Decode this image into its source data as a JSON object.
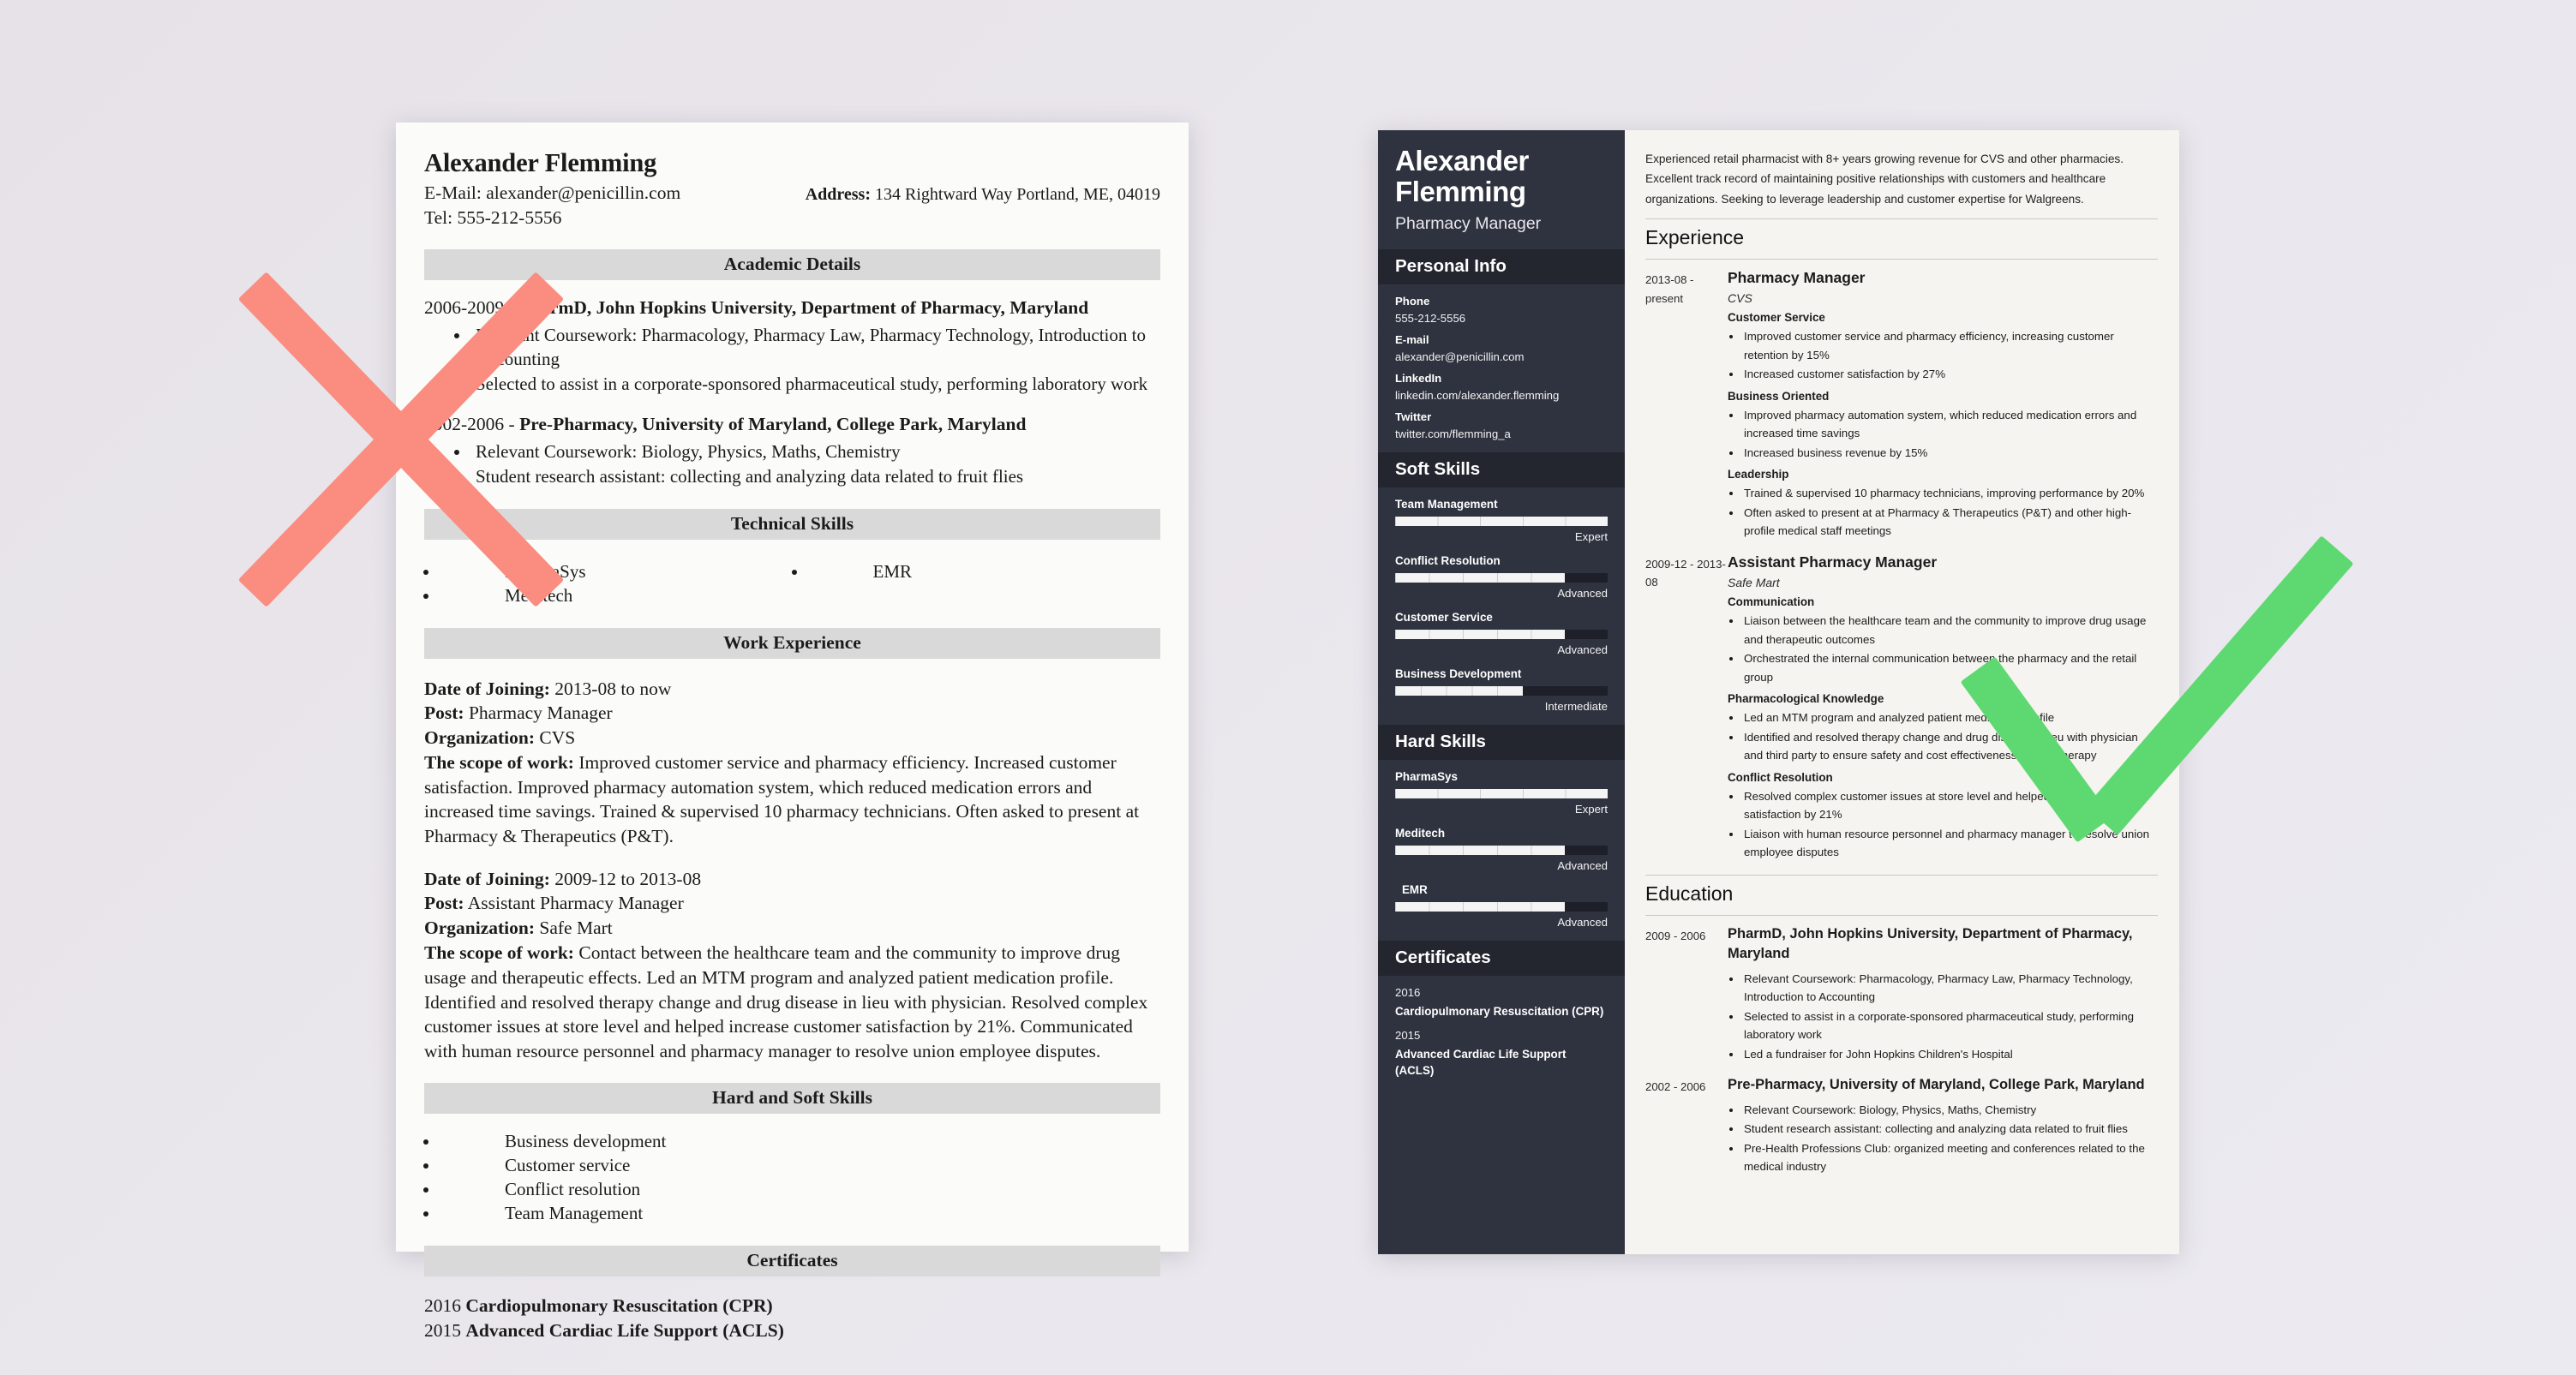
{
  "marks": {
    "reject_color": "#fa8c80",
    "accept_color": "#5ed870",
    "reject_name": "red-x-mark",
    "accept_name": "green-check-mark"
  },
  "bad_resume": {
    "name": "Alexander Flemming",
    "email_line": "E-Mail: alexander@penicillin.com",
    "tel_line": "Tel: 555-212-5556",
    "address_label": "Address:",
    "address_value": "134 Rightward Way Portland, ME, 04019",
    "sections": {
      "academic": "Academic Details",
      "technical": "Technical Skills",
      "work": "Work Experience",
      "skills": "Hard and Soft Skills",
      "certificates": "Certificates"
    },
    "education": [
      {
        "years": "2006-2009 - ",
        "title": "PharmD, John Hopkins University, Department of Pharmacy, Maryland",
        "bullets": [
          "Relevant Coursework: Pharmacology, Pharmacy Law, Pharmacy Technology, Introduction to Accounting",
          "Selected to assist in a corporate-sponsored pharmaceutical study, performing laboratory work"
        ]
      },
      {
        "years": "2002-2006 - ",
        "title": "Pre-Pharmacy, University of Maryland, College Park, Maryland",
        "bullets": [
          "Relevant Coursework: Biology, Physics, Maths, Chemistry",
          "Student research assistant: collecting and analyzing data related to fruit flies"
        ]
      }
    ],
    "technical_skills_left": [
      "PharmaSys",
      "Meditech"
    ],
    "technical_skills_right": [
      "EMR"
    ],
    "jobs": [
      {
        "date_label": "Date of Joining:",
        "date_value": " 2013-08 to now",
        "post_label": "Post:",
        "post_value": " Pharmacy Manager",
        "org_label": "Organization:",
        "org_value": " CVS",
        "scope_label": "The scope of work:",
        "scope_value": " Improved customer service and pharmacy efficiency. Increased customer satisfaction. Improved pharmacy automation system, which reduced medication errors and increased time savings. Trained & supervised 10 pharmacy technicians. Often asked to present at Pharmacy & Therapeutics (P&T)."
      },
      {
        "date_label": "Date of Joining:",
        "date_value": " 2009-12 to 2013-08",
        "post_label": "Post:",
        "post_value": " Assistant Pharmacy Manager",
        "org_label": "Organization:",
        "org_value": " Safe Mart",
        "scope_label": "The scope of work:",
        "scope_value": " Contact between the healthcare team and the community to improve drug usage and therapeutic effects. Led an MTM program and analyzed patient medication profile. Identified and resolved therapy change and drug disease in lieu with physician. Resolved complex customer issues at store level and helped increase customer satisfaction by 21%. Communicated with human resource personnel and pharmacy manager to resolve union employee disputes."
      }
    ],
    "soft_skills": [
      "Business development",
      "Customer service",
      "Conflict resolution",
      "Team Management"
    ],
    "certificates": [
      {
        "year": "2016 ",
        "name": "Cardiopulmonary Resuscitation (CPR)"
      },
      {
        "year": "2015 ",
        "name": "Advanced Cardiac Life Support (ACLS)"
      }
    ]
  },
  "good_resume": {
    "sidebar": {
      "name": "Alexander Flemming",
      "title": "Pharmacy Manager",
      "personal_info_heading": "Personal Info",
      "contacts": [
        {
          "label": "Phone",
          "value": "555-212-5556"
        },
        {
          "label": "E-mail",
          "value": "alexander@penicillin.com"
        },
        {
          "label": "LinkedIn",
          "value": "linkedin.com/alexander.flemming"
        },
        {
          "label": "Twitter",
          "value": "twitter.com/flemming_a"
        }
      ],
      "soft_skills_heading": "Soft Skills",
      "soft_skills": [
        {
          "name": "Team Management",
          "level": "Expert",
          "percent": 100
        },
        {
          "name": "Conflict Resolution",
          "level": "Advanced",
          "percent": 80
        },
        {
          "name": "Customer Service",
          "level": "Advanced",
          "percent": 80
        },
        {
          "name": "Business Development",
          "level": "Intermediate",
          "percent": 60
        }
      ],
      "hard_skills_heading": "Hard Skills",
      "hard_skills": [
        {
          "name": "PharmaSys",
          "level": "Expert",
          "percent": 100
        },
        {
          "name": "Meditech",
          "level": "Advanced",
          "percent": 80
        },
        {
          "name": "EMR",
          "level": "Advanced",
          "percent": 80
        }
      ],
      "certificates_heading": "Certificates",
      "certificates": [
        {
          "year": "2016",
          "name": "Cardiopulmonary Resuscitation (CPR)"
        },
        {
          "year": "2015",
          "name": "Advanced Cardiac Life Support (ACLS)"
        }
      ]
    },
    "main": {
      "summary": "Experienced retail pharmacist with 8+ years growing revenue for CVS and other pharmacies. Excellent track record of maintaining positive relationships with customers and healthcare organizations. Seeking to leverage leadership and customer expertise for Walgreens.",
      "experience_heading": "Experience",
      "education_heading": "Education",
      "experience": [
        {
          "date": "2013-08 - present",
          "role": "Pharmacy Manager",
          "org": "CVS",
          "groups": [
            {
              "label": "Customer Service",
              "bullets": [
                "Improved customer service and pharmacy efficiency, increasing customer retention by 15%",
                "Increased customer satisfaction by 27%"
              ]
            },
            {
              "label": "Business Oriented",
              "bullets": [
                "Improved pharmacy automation system, which reduced medication errors and increased time savings",
                "Increased business revenue by 15%"
              ]
            },
            {
              "label": "Leadership",
              "bullets": [
                "Trained & supervised 10 pharmacy technicians, improving performance by 20%",
                "Often asked to present at at Pharmacy & Therapeutics (P&T) and other high-profile medical staff meetings"
              ]
            }
          ]
        },
        {
          "date": "2009-12 - 2013-08",
          "role": "Assistant Pharmacy Manager",
          "org": "Safe Mart",
          "groups": [
            {
              "label": "Communication",
              "bullets": [
                "Liaison between the healthcare team and the community to improve drug usage and therapeutic outcomes",
                "Orchestrated the internal communication between the pharmacy and the retail group"
              ]
            },
            {
              "label": "Pharmacological Knowledge",
              "bullets": [
                "Led an MTM program and analyzed patient medication profile",
                "Identified and resolved therapy change and drug disease in lieu with physician and third party to ensure safety and cost effectiveness of drug therapy"
              ]
            },
            {
              "label": "Conflict Resolution",
              "bullets": [
                "Resolved complex customer issues at store level and helped increase customer satisfaction by 21%",
                "Liaison with human resource personnel and pharmacy manager to resolve union employee disputes"
              ]
            }
          ]
        }
      ],
      "education": [
        {
          "date": "2009 - 2006",
          "title": "PharmD, John Hopkins University, Department of Pharmacy, Maryland",
          "bullets": [
            "Relevant Coursework: Pharmacology, Pharmacy Law, Pharmacy Technology, Introduction to Accounting",
            "Selected to assist in a corporate-sponsored pharmaceutical study, performing laboratory work",
            "Led a fundraiser for John Hopkins Children's Hospital"
          ]
        },
        {
          "date": "2002 - 2006",
          "title": "Pre-Pharmacy, University of Maryland, College Park, Maryland",
          "bullets": [
            "Relevant Coursework: Biology, Physics, Maths, Chemistry",
            "Student research assistant: collecting and analyzing data related to fruit flies",
            "Pre-Health Professions Club: organized meeting and conferences related to the medical industry"
          ]
        }
      ]
    }
  }
}
